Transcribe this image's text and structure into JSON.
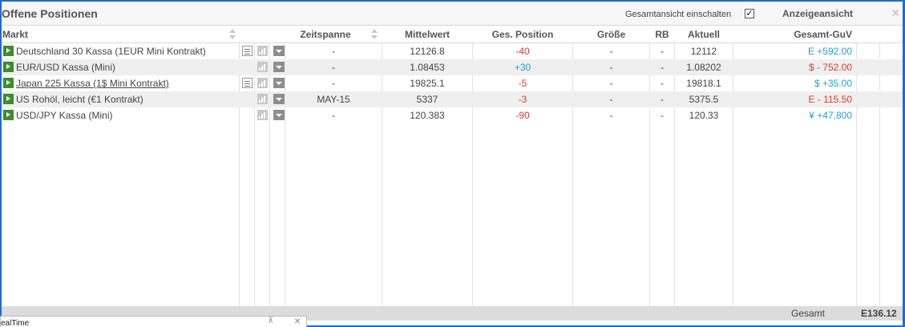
{
  "window": {
    "title": "Offene Positionen",
    "overview_label": "Gesamtansicht einschalten",
    "overview_checked": true,
    "view_label": "Anzeigeansicht",
    "close_glyph": "×"
  },
  "columns": {
    "market": "Markt",
    "period": "Zeitspanne",
    "mid": "Mittelwert",
    "position": "Ges. Position",
    "size": "Größe",
    "rb": "RB",
    "current": "Aktuell",
    "pnl": "Gesamt-GuV"
  },
  "rows": [
    {
      "market": "Deutschland 30 Kassa (1EUR Mini Kontrakt)",
      "has_doc": true,
      "underline": false,
      "period": "-",
      "mid": "12126.8",
      "position": "-40",
      "position_sign": "neg",
      "size": "-",
      "rb": "-",
      "current": "12112",
      "pnl": "E +592.00",
      "pnl_sign": "pos"
    },
    {
      "market": "EUR/USD Kassa (Mini)",
      "has_doc": false,
      "underline": false,
      "period": "-",
      "mid": "1.08453",
      "position": "+30",
      "position_sign": "pos",
      "size": "-",
      "rb": "-",
      "current": "1.08202",
      "pnl": "$ - 752.00",
      "pnl_sign": "neg"
    },
    {
      "market": "Japan 225 Kassa (1$ Mini Kontrakt)",
      "has_doc": true,
      "underline": true,
      "period": "-",
      "mid": "19825.1",
      "position": "-5",
      "position_sign": "neg",
      "size": "-",
      "rb": "-",
      "current": "19818.1",
      "pnl": "$ +35.00",
      "pnl_sign": "pos"
    },
    {
      "market": "US Rohöl, leicht (€1 Kontrakt)",
      "has_doc": false,
      "underline": false,
      "period": "MAY-15",
      "mid": "5337",
      "position": "-3",
      "position_sign": "neg",
      "size": "-",
      "rb": "-",
      "current": "5375.5",
      "pnl": "E - 115.50",
      "pnl_sign": "neg"
    },
    {
      "market": "USD/JPY Kassa (Mini)",
      "has_doc": false,
      "underline": false,
      "period": "-",
      "mid": "120.383",
      "position": "-90",
      "position_sign": "neg",
      "size": "-",
      "rb": "-",
      "current": "120.33",
      "pnl": "¥ +47,800",
      "pnl_sign": "pos"
    }
  ],
  "footer": {
    "total_label": "Gesamt",
    "total_value": "E136.12"
  },
  "subwindow": {
    "title": "ealTime"
  },
  "colors": {
    "positive": "#1f9fd8",
    "negative": "#e03a2e",
    "accent_border": "#1f6bcf",
    "market_icon": "#3c8d2e"
  },
  "icons": {
    "row_status": "play-icon",
    "details": "document-icon",
    "chart": "bar-chart-icon",
    "menu": "dropdown-icon",
    "sort": "sort-icon"
  }
}
